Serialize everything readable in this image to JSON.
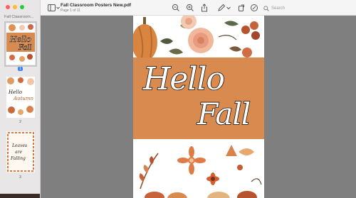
{
  "window": {
    "traffic_lights": [
      "#ff5f57",
      "#febc2e",
      "#28c840"
    ]
  },
  "sidebar": {
    "title": "Fall Classroom...",
    "thumbnails": [
      {
        "page": "1",
        "selected": true
      },
      {
        "page": "2",
        "selected": false
      },
      {
        "page": "3",
        "selected": false
      }
    ]
  },
  "toolbar": {
    "title": "Fall Classroom Posters New.pdf",
    "subtitle": "Page 1 of 11",
    "search_placeholder": "Search",
    "icons": [
      "sidebar-toggle-icon",
      "zoom-out-icon",
      "zoom-in-icon",
      "share-icon",
      "markup-pen-icon",
      "rotate-icon",
      "annotate-icon",
      "search-icon"
    ]
  },
  "document": {
    "poster_line1": "Hello",
    "poster_line2": "Fall",
    "band_color": "#d98a4f"
  }
}
